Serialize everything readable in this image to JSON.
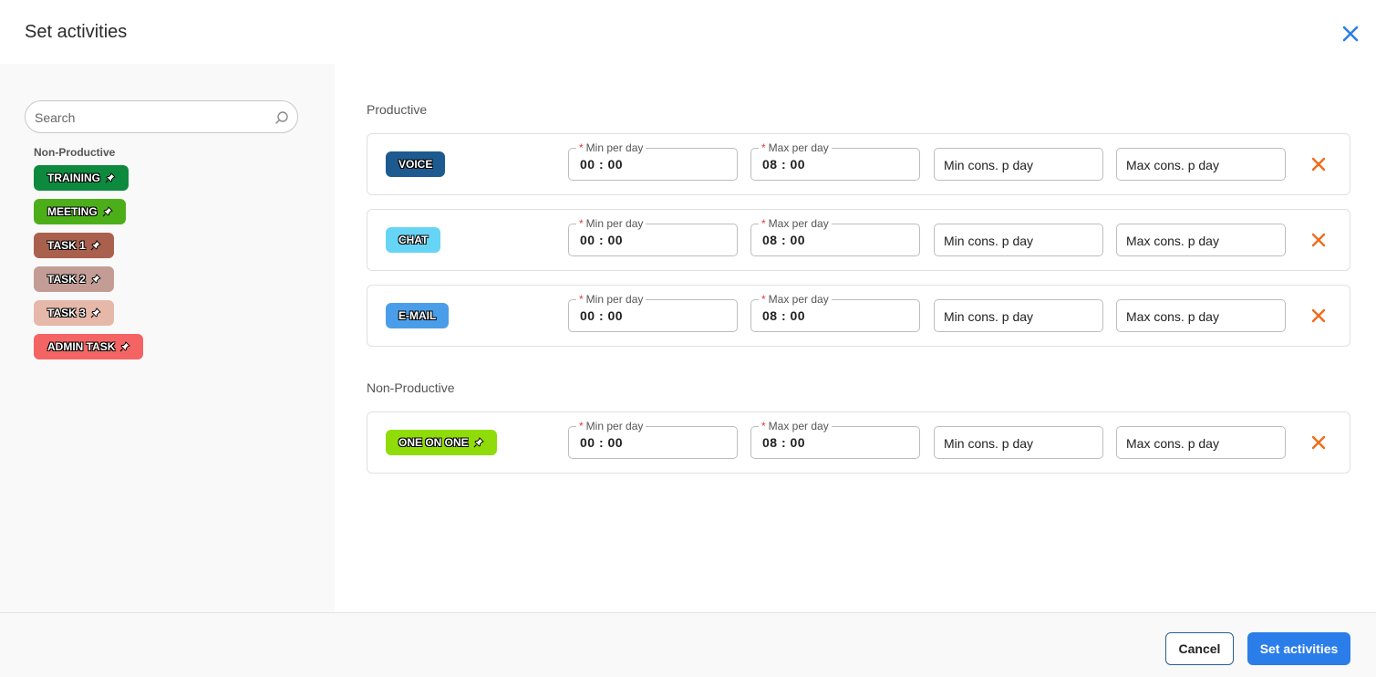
{
  "dialog": {
    "title": "Set activities",
    "close_icon": "close-icon"
  },
  "sidebar": {
    "search_placeholder": "Search",
    "group_label": "Non-Productive",
    "items": [
      {
        "label": "TRAINING",
        "color": "#0e8a3e"
      },
      {
        "label": "MEETING",
        "color": "#4caf1a"
      },
      {
        "label": "TASK 1",
        "color": "#a9604d"
      },
      {
        "label": "TASK 2",
        "color": "#c39d95"
      },
      {
        "label": "TASK 3",
        "color": "#e6b8aa"
      },
      {
        "label": "ADMIN TASK",
        "color": "#f46464"
      }
    ]
  },
  "main": {
    "productive_label": "Productive",
    "non_productive_label": "Non-Productive",
    "field_labels": {
      "min_per_day": "Min per day",
      "max_per_day": "Max per day",
      "required_mark": "*",
      "min_cons": "Min cons. p day",
      "max_cons": "Max cons. p day"
    },
    "productive_rows": [
      {
        "activity": "VOICE",
        "color": "#1d5a8f",
        "pinned": false,
        "min": "00 : 00",
        "max": "08 : 00"
      },
      {
        "activity": "CHAT",
        "color": "#66d4f5",
        "pinned": false,
        "min": "00 : 00",
        "max": "08 : 00"
      },
      {
        "activity": "E-MAIL",
        "color": "#4a9de8",
        "pinned": false,
        "min": "00 : 00",
        "max": "08 : 00"
      }
    ],
    "non_productive_rows": [
      {
        "activity": "ONE ON ONE",
        "color": "#8fdc0a",
        "pinned": true,
        "min": "00 : 00",
        "max": "08 : 00"
      }
    ]
  },
  "footer": {
    "cancel_label": "Cancel",
    "submit_label": "Set activities"
  },
  "colors": {
    "accent": "#2b7de9",
    "remove": "#ef6c1a"
  }
}
